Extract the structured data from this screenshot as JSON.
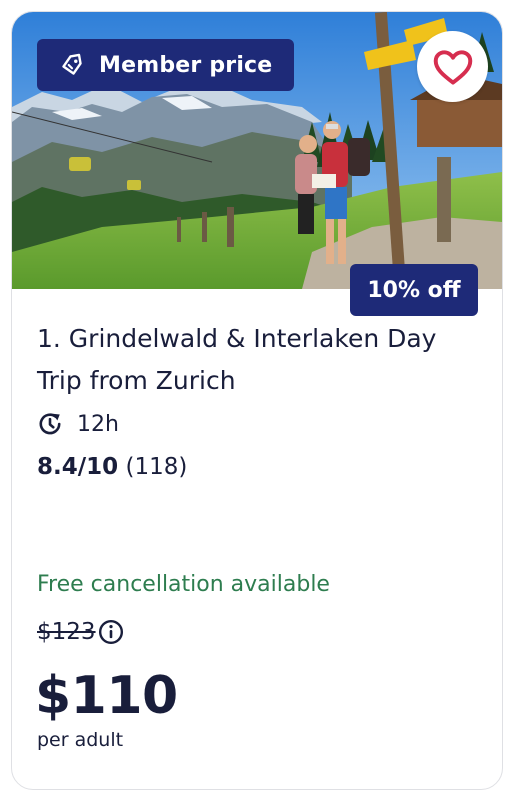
{
  "badges": {
    "member_price": "Member price",
    "discount": "10% off"
  },
  "listing": {
    "title": "1. Grindelwald & Interlaken Day Trip from Zurich",
    "duration": "12h",
    "rating_score": "8.4/10",
    "review_count": "(118)",
    "cancellation": "Free cancellation available",
    "original_price": "$123",
    "price": "$110",
    "price_unit": "per adult"
  },
  "icons": {
    "member": "tag-icon",
    "favorite": "heart-icon",
    "duration": "clock-icon",
    "price_info": "info-icon"
  },
  "colors": {
    "badge_bg": "#1e2a78",
    "heart": "#d62e4f",
    "cancellation_text": "#2e7d4f",
    "text": "#191e3b"
  }
}
